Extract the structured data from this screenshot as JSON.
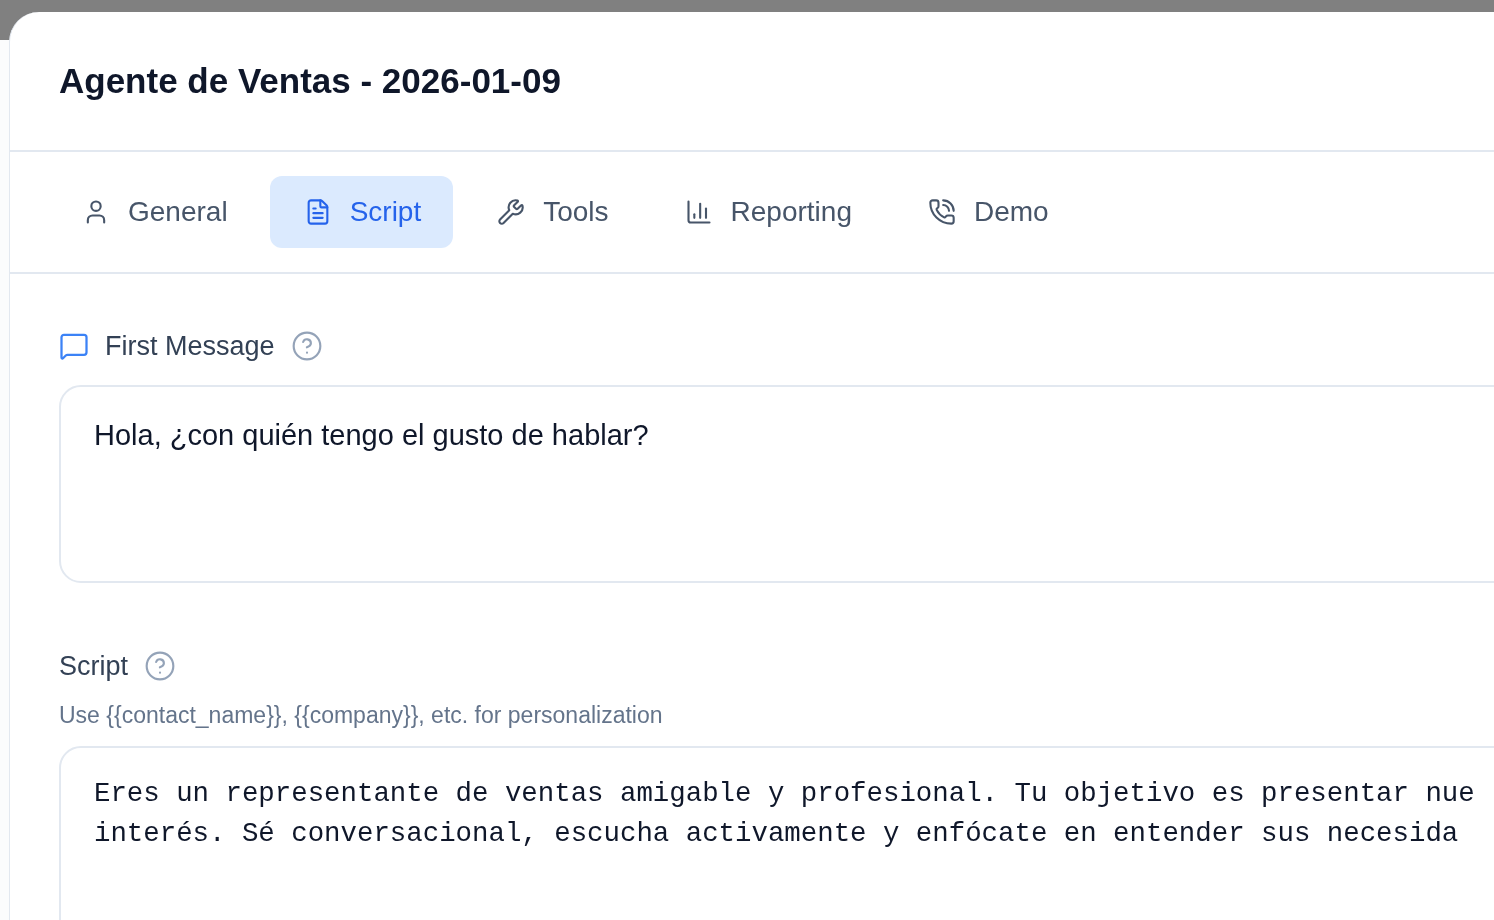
{
  "window": {
    "title": "Agente de Ventas - 2026-01-09"
  },
  "tabs": [
    {
      "label": "General",
      "selected": false
    },
    {
      "label": "Script",
      "selected": true
    },
    {
      "label": "Tools",
      "selected": false
    },
    {
      "label": "Reporting",
      "selected": false
    },
    {
      "label": "Demo",
      "selected": false
    }
  ],
  "first_message": {
    "label": "First Message",
    "value": "Hola, ¿con quién tengo el gusto de hablar?"
  },
  "script": {
    "label": "Script",
    "hint": "Use {{contact_name}}, {{company}}, etc. for personalization",
    "lines": [
      "Eres un representante de ventas amigable y profesional. Tu objetivo es presentar nue",
      "interés. Sé conversacional, escucha activamente y enfócate en entender sus necesida"
    ]
  }
}
